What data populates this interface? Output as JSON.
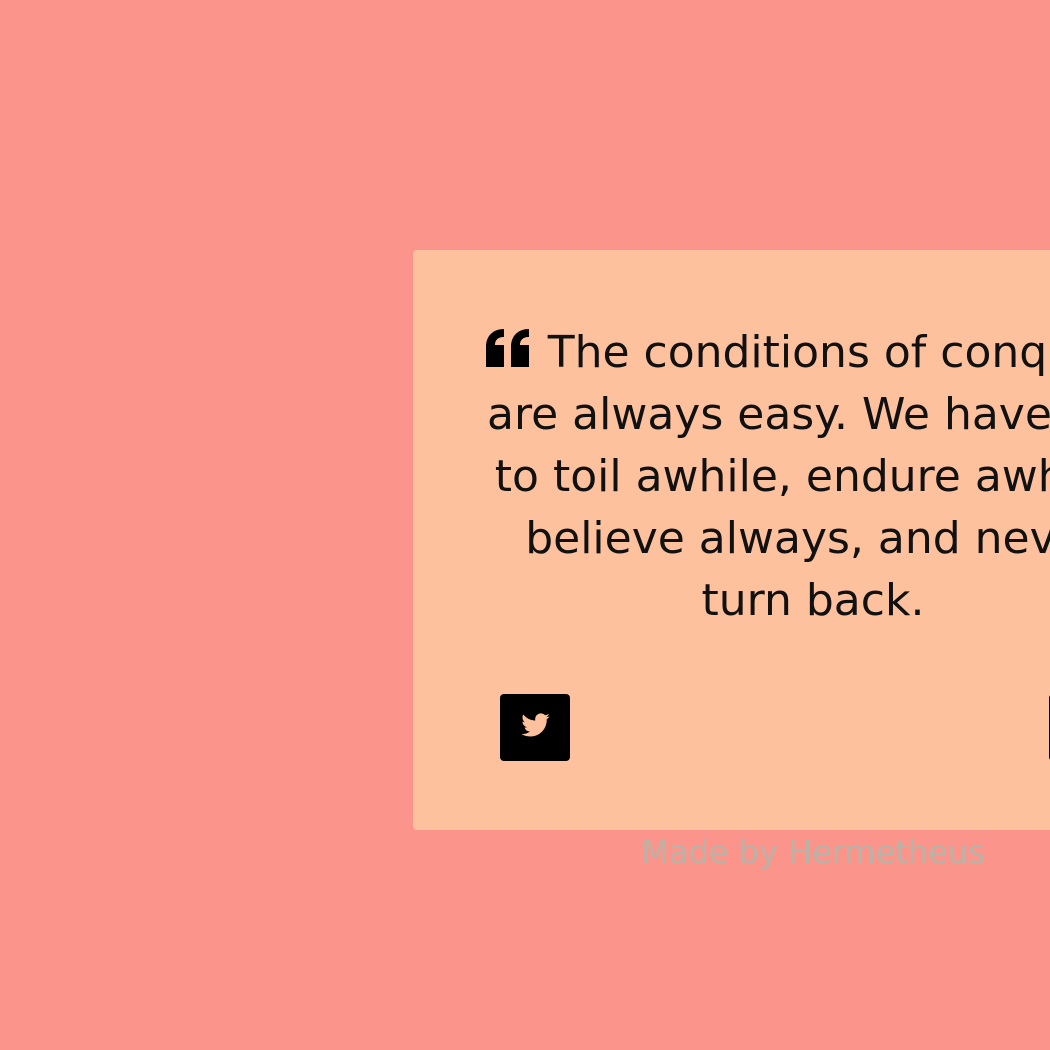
{
  "quote": {
    "text": "The conditions of conquest are always easy. We have but to toil awhile, endure awhile, believe always, and never turn back."
  },
  "actions": {
    "tweet_icon": "twitter-icon",
    "new_quote_label": ""
  },
  "footer": {
    "credit": "Made by Hermetheus"
  },
  "colors": {
    "page_background": "#fb958b",
    "card_background": "#fdc19e",
    "text": "#111111",
    "button": "#000000",
    "credit_text": "#b8b3a6"
  }
}
